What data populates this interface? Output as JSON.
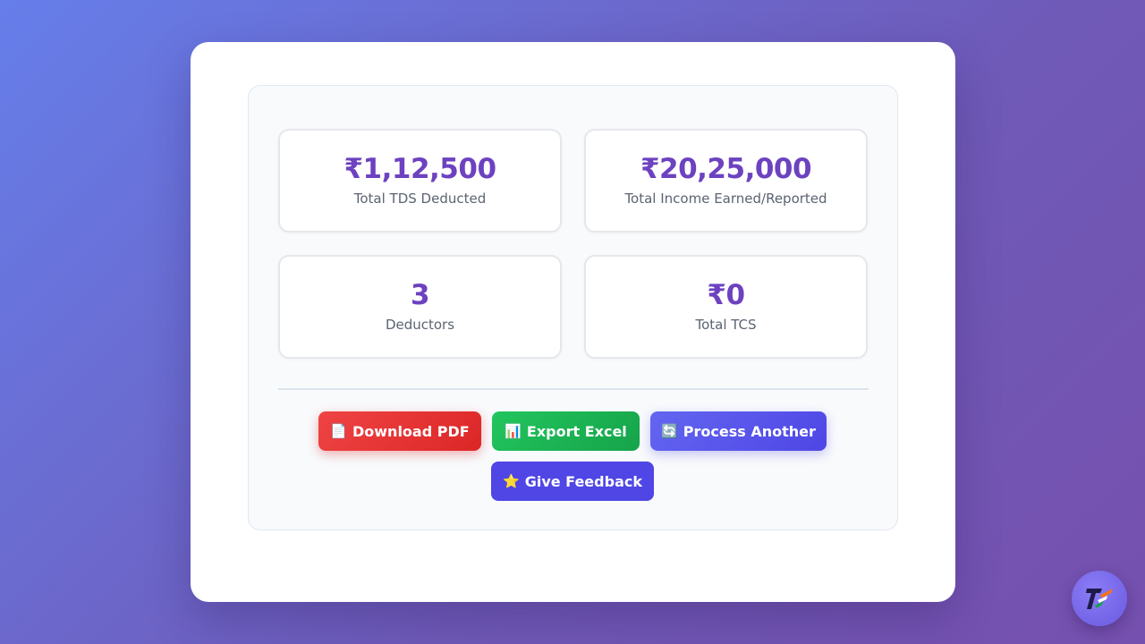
{
  "stats": [
    {
      "value": "₹1,12,500",
      "label": "Total TDS Deducted"
    },
    {
      "value": "₹20,25,000",
      "label": "Total Income Earned/Reported"
    },
    {
      "value": "3",
      "label": "Deductors"
    },
    {
      "value": "₹0",
      "label": "Total TCS"
    }
  ],
  "actions": {
    "download_pdf": {
      "icon": "📄",
      "label": "Download PDF",
      "icon_name": "document-icon"
    },
    "export_excel": {
      "icon": "📊",
      "label": "Export Excel",
      "icon_name": "bar-chart-icon"
    },
    "process_another": {
      "icon": "🔄",
      "label": "Process Another",
      "icon_name": "refresh-icon"
    },
    "give_feedback": {
      "icon": "⭐",
      "label": "Give Feedback",
      "icon_name": "star-icon"
    }
  },
  "colors": {
    "accent": "#6d42c0",
    "pdf": "#dc2626",
    "excel": "#16a34a",
    "primary": "#4f46e5"
  },
  "fab": {
    "icon_name": "tf-logo-icon"
  }
}
